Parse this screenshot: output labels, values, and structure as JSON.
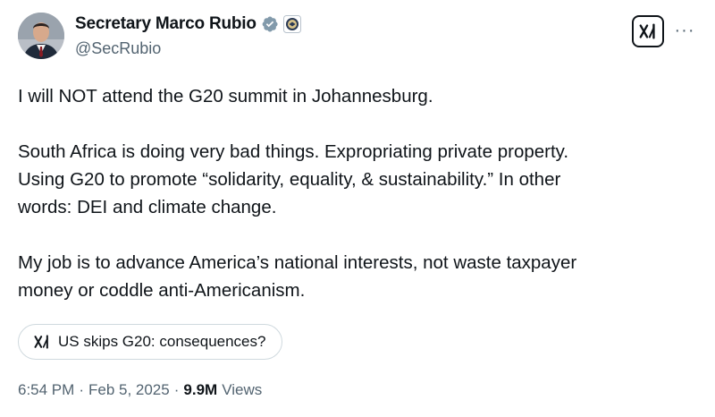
{
  "author": {
    "display_name": "Secretary Marco Rubio",
    "handle": "@SecRubio",
    "icons": [
      "verified-badge-icon",
      "government-seal-icon"
    ]
  },
  "header": {
    "grok_button_icon": "grok-icon",
    "more_button_label": "···"
  },
  "tweet": {
    "paragraph_1": "I will NOT attend the G20 summit in Johannesburg.",
    "paragraph_2_line_1": "South Africa is doing very bad things. Expropriating private property.",
    "paragraph_2_line_2": "Using G20 to promote “solidarity, equality, & sustainability.” In other",
    "paragraph_2_line_3": "words: DEI and climate change.",
    "paragraph_3_line_1": "My job is to advance America’s national interests, not waste taxpayer",
    "paragraph_3_line_2": "money or coddle anti-Americanism."
  },
  "grok_suggestion": {
    "label": "US skips G20: consequences?",
    "icon": "grok-icon"
  },
  "meta": {
    "time": "6:54 PM",
    "separator": "·",
    "date": "Feb 5, 2025",
    "views_count": "9.9M",
    "views_label": "Views"
  },
  "colors": {
    "text_primary": "#0f1419",
    "text_secondary": "#536471",
    "verified_badge": "#829aab",
    "chip_border": "#cfd9de"
  }
}
